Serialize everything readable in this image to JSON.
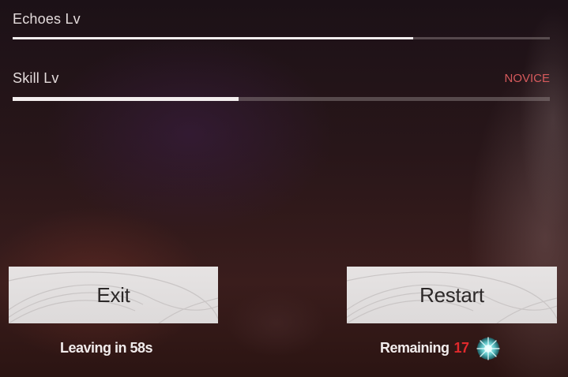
{
  "stats": {
    "echoes": {
      "label": "Echoes Lv",
      "progress": 0.745
    },
    "skill": {
      "label": "Skill Lv",
      "rank": "NOVICE",
      "progress": 0.42
    }
  },
  "buttons": {
    "exit_label": "Exit",
    "restart_label": "Restart"
  },
  "captions": {
    "leaving": "Leaving in 58s",
    "remaining_label": "Remaining",
    "remaining_count": "17",
    "remaining_icon": "crystal-gem-icon"
  },
  "colors": {
    "rank": "#d65a5c",
    "remaining_count": "#e0292c",
    "gem": "#7fe0e0"
  }
}
